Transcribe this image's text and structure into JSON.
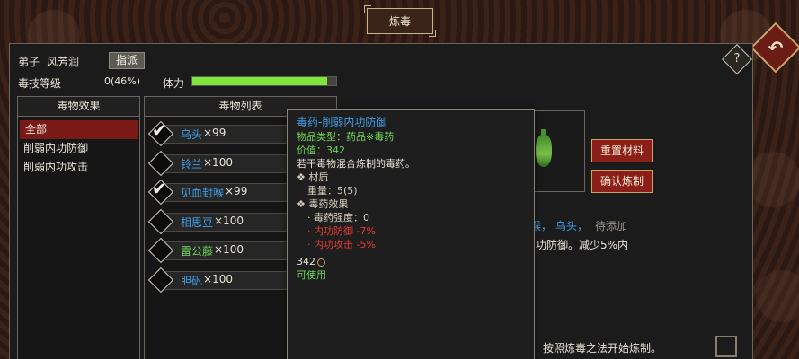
{
  "window": {
    "title": "炼毒"
  },
  "header": {
    "disciple_label": "弟子",
    "disciple_name": "风芳润",
    "assign_button": "指派",
    "skill_label": "毒技等级",
    "skill_value": "0(46%)",
    "stamina_label": "体力",
    "stamina_fraction": 0.94,
    "help_icon_glyph": "?",
    "back_icon_glyph": "↶"
  },
  "effects": {
    "header": "毒物效果",
    "items": [
      {
        "label": "全部",
        "active": true
      },
      {
        "label": "削弱内功防御",
        "active": false
      },
      {
        "label": "削弱内功攻击",
        "active": false
      }
    ]
  },
  "poisons": {
    "header": "毒物列表",
    "items": [
      {
        "name": "乌头",
        "count": "×99",
        "checked": true,
        "color": "#3fa0e8"
      },
      {
        "name": "铃兰",
        "count": "×100",
        "checked": false,
        "color": "#3fa0e8"
      },
      {
        "name": "见血封喉",
        "count": "×99",
        "checked": true,
        "color": "#3fa0e8"
      },
      {
        "name": "相思豆",
        "count": "×100",
        "checked": false,
        "color": "#3fa0e8"
      },
      {
        "name": "雷公藤",
        "count": "×100",
        "checked": false,
        "color": "#6fd45a"
      },
      {
        "name": "胆矾",
        "count": "×100",
        "checked": false,
        "color": "#3fa0e8"
      }
    ]
  },
  "right": {
    "reset_button": "重置材料",
    "confirm_button": "确认炼制",
    "recipe_part1": "喉，",
    "recipe_part2": "乌头，",
    "recipe_part3": "待添加",
    "effect_text": "功防御。减少5%内",
    "bottom_text": "按照炼毒之法开始炼制。"
  },
  "tooltip": {
    "title": "毒药-削弱内功防御",
    "type_line": "物品类型：药品※毒药",
    "price_line": "价值：342",
    "desc": "若干毒物混合炼制的毒药。",
    "material_header": "❖ 材质",
    "weight_line": "重量：5(5)",
    "effect_header": "❖ 毒药效果",
    "effect_lines": [
      {
        "text": "· 毒药强度：0",
        "red": false
      },
      {
        "text": "· 内功防御 -7%",
        "red": true
      },
      {
        "text": "· 内功攻击 -5%",
        "red": true
      }
    ],
    "price_icon_line": "342",
    "usable": "可使用"
  }
}
